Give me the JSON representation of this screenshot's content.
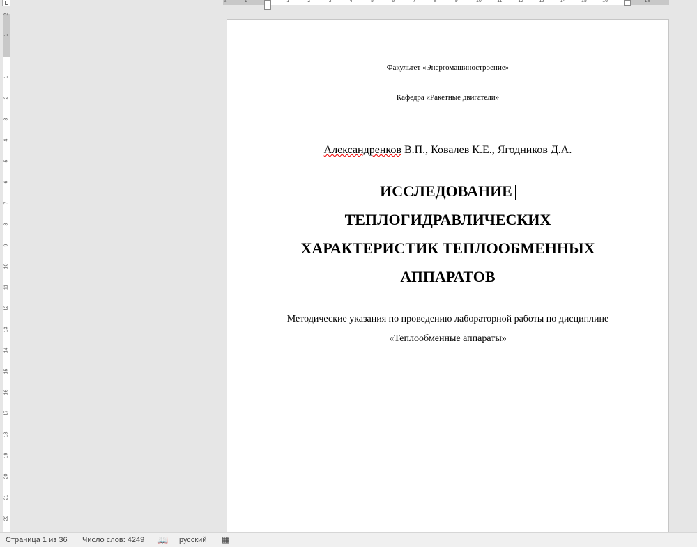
{
  "ruler": {
    "top_labels": [
      "2",
      "1",
      "1",
      "2",
      "3",
      "4",
      "5",
      "6",
      "7",
      "8",
      "9",
      "10",
      "11",
      "12",
      "13",
      "14",
      "15",
      "16",
      "18"
    ],
    "left_labels": [
      "2",
      "1",
      "1",
      "2",
      "3",
      "4",
      "5",
      "6",
      "7",
      "8",
      "9",
      "10",
      "11",
      "12",
      "13",
      "14",
      "15",
      "16",
      "17",
      "18",
      "19",
      "20",
      "21",
      "22"
    ]
  },
  "document": {
    "faculty": "Факультет «Энергомашиностроение»",
    "department": "Кафедра «Ракетные двигатели»",
    "authors_first": "Александренков",
    "authors_rest": " В.П., Ковалев К.Е., Ягодников Д.А.",
    "title_lines": [
      "ИССЛЕДОВАНИЕ",
      "ТЕПЛОГИДРАВЛИЧЕСКИХ",
      "ХАРАКТЕРИСТИК ТЕПЛООБМЕННЫХ",
      "АППАРАТОВ"
    ],
    "subtitle_lines": [
      "Методические указания по проведению лабораторной работы по дисциплине",
      "«Теплообменные аппараты»"
    ]
  },
  "status": {
    "page": "Страница 1 из 36",
    "words": "Число слов: 4249",
    "language": "русский"
  }
}
